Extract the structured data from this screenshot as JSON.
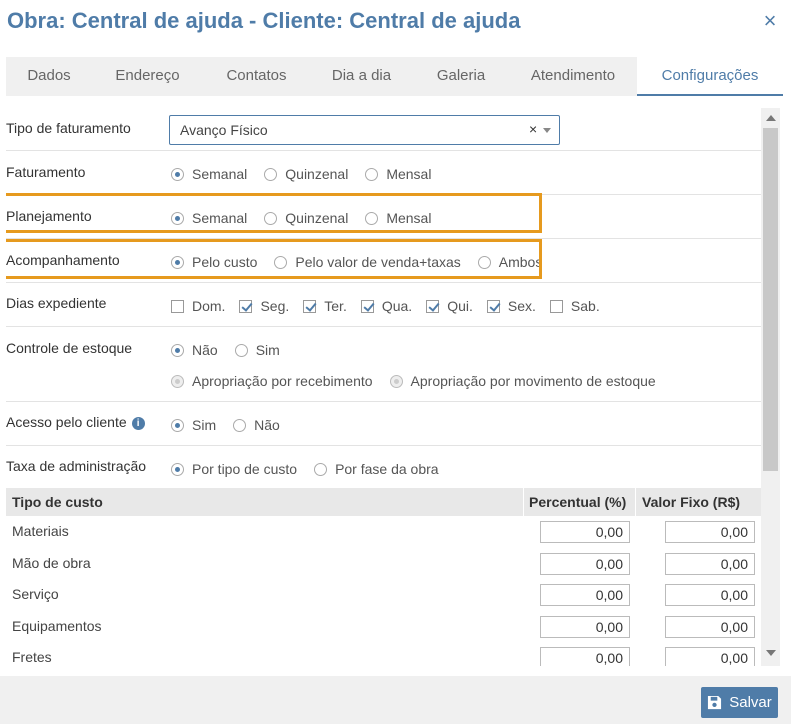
{
  "header": {
    "title": "Obra: Central de ajuda - Cliente: Central de ajuda",
    "close": "×"
  },
  "tabs": [
    "Dados",
    "Endereço",
    "Contatos",
    "Dia a dia",
    "Galeria",
    "Atendimento",
    "Configurações"
  ],
  "active_tab": "Configurações",
  "form": {
    "tipo_faturamento": {
      "label": "Tipo de faturamento",
      "value": "Avanço Físico",
      "clear": "×"
    },
    "faturamento": {
      "label": "Faturamento",
      "options": [
        "Semanal",
        "Quinzenal",
        "Mensal"
      ],
      "selected": "Semanal"
    },
    "planejamento": {
      "label": "Planejamento",
      "options": [
        "Semanal",
        "Quinzenal",
        "Mensal"
      ],
      "selected": "Semanal"
    },
    "acompanhamento": {
      "label": "Acompanhamento",
      "options": [
        "Pelo custo",
        "Pelo valor de venda+taxas",
        "Ambos"
      ],
      "selected": "Pelo custo"
    },
    "dias_expediente": {
      "label": "Dias expediente",
      "days": [
        {
          "label": "Dom.",
          "checked": false
        },
        {
          "label": "Seg.",
          "checked": true
        },
        {
          "label": "Ter.",
          "checked": true
        },
        {
          "label": "Qua.",
          "checked": true
        },
        {
          "label": "Qui.",
          "checked": true
        },
        {
          "label": "Sex.",
          "checked": true
        },
        {
          "label": "Sab.",
          "checked": false
        }
      ]
    },
    "controle_estoque": {
      "label": "Controle de estoque",
      "options": [
        "Não",
        "Sim"
      ],
      "selected": "Não",
      "sub_options": [
        "Apropriação por recebimento",
        "Apropriação por movimento de estoque"
      ]
    },
    "acesso_cliente": {
      "label": "Acesso pelo cliente",
      "info": "i",
      "options": [
        "Sim",
        "Não"
      ],
      "selected": "Sim"
    },
    "taxa_administracao": {
      "label": "Taxa de administração",
      "options": [
        "Por tipo de custo",
        "Por fase da obra"
      ],
      "selected": "Por tipo de custo"
    }
  },
  "table": {
    "headers": [
      "Tipo de custo",
      "Percentual (%)",
      "Valor Fixo (R$)"
    ],
    "rows": [
      {
        "name": "Materiais",
        "percentual": "0,00",
        "valor": "0,00"
      },
      {
        "name": "Mão de obra",
        "percentual": "0,00",
        "valor": "0,00"
      },
      {
        "name": "Serviço",
        "percentual": "0,00",
        "valor": "0,00"
      },
      {
        "name": "Equipamentos",
        "percentual": "0,00",
        "valor": "0,00"
      },
      {
        "name": "Fretes",
        "percentual": "0,00",
        "valor": "0,00"
      }
    ]
  },
  "footer": {
    "save_label": "Salvar"
  },
  "colors": {
    "accent": "#4f7ca8",
    "highlight": "#e69a1e"
  }
}
